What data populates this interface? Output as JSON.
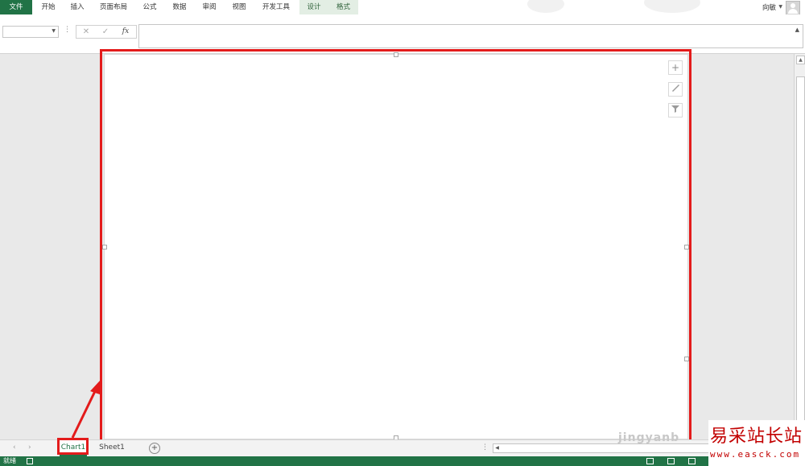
{
  "ribbon": {
    "tabs": [
      {
        "label": "文件"
      },
      {
        "label": "开始"
      },
      {
        "label": "插入"
      },
      {
        "label": "页面布局"
      },
      {
        "label": "公式"
      },
      {
        "label": "数据"
      },
      {
        "label": "审阅"
      },
      {
        "label": "视图"
      },
      {
        "label": "开发工具"
      },
      {
        "label": "设计"
      },
      {
        "label": "格式"
      }
    ],
    "user_name": "向敏"
  },
  "formula_bar": {
    "name_box_value": "",
    "cancel_symbol": "✕",
    "enter_symbol": "✓",
    "function_symbol": "fx",
    "formula_value": ""
  },
  "chart_buttons": {
    "elements_symbol": "+"
  },
  "sheets": {
    "nav_prev": "‹",
    "nav_next": "›",
    "tabs": [
      {
        "label": "Chart1",
        "active": true
      },
      {
        "label": "Sheet1",
        "active": false
      }
    ],
    "add_symbol": "+"
  },
  "watermark_partial": "jingyanb",
  "status": {
    "ready_text": "就绪"
  },
  "watermark": {
    "name": "易采站长站",
    "url": "www.easck.com"
  },
  "colors": {
    "excel_green": "#217346",
    "context_tab_bg": "#e3eee4",
    "highlight_red": "#e31b1b",
    "watermark_red": "#c20000"
  }
}
